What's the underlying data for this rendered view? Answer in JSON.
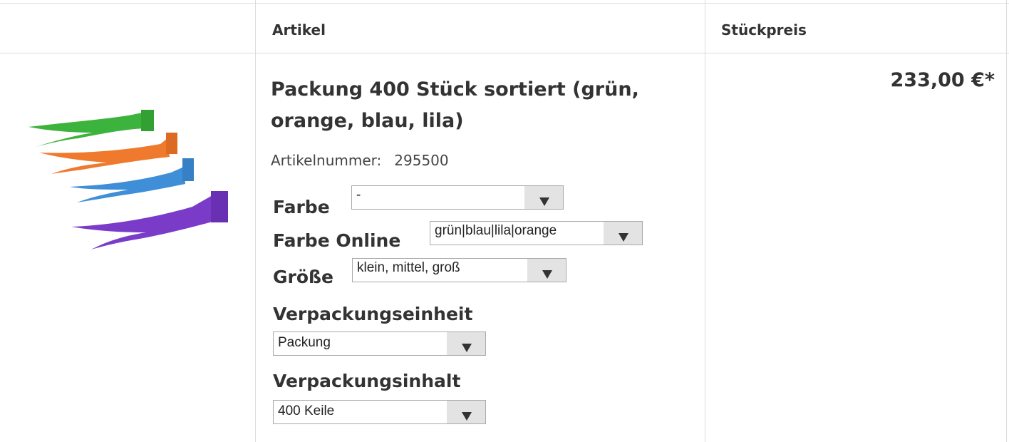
{
  "header": {
    "col_article": "Artikel",
    "col_unit_price": "Stückpreis"
  },
  "product": {
    "title": "Packung 400 Stück sortiert (grün, orange, blau, lila)",
    "article_number_label": "Artikelnummer:",
    "article_number": "295500",
    "price": "233,00 €*",
    "image_icon": "colored-wedges-image",
    "colors": [
      "#3cb33c",
      "#ef7a2e",
      "#3e8ed8",
      "#7a3cc8"
    ]
  },
  "options": {
    "farbe": {
      "label": "Farbe",
      "value": "-"
    },
    "farbe_online": {
      "label": "Farbe Online",
      "value": "grün|blau|lila|orange"
    },
    "groesse": {
      "label": "Größe",
      "value": "klein, mittel, groß"
    },
    "verpackungseinheit": {
      "label": "Verpackungseinheit",
      "value": "Packung"
    },
    "verpackungsinhalt": {
      "label": "Verpackungsinhalt",
      "value": "400 Keile"
    }
  }
}
